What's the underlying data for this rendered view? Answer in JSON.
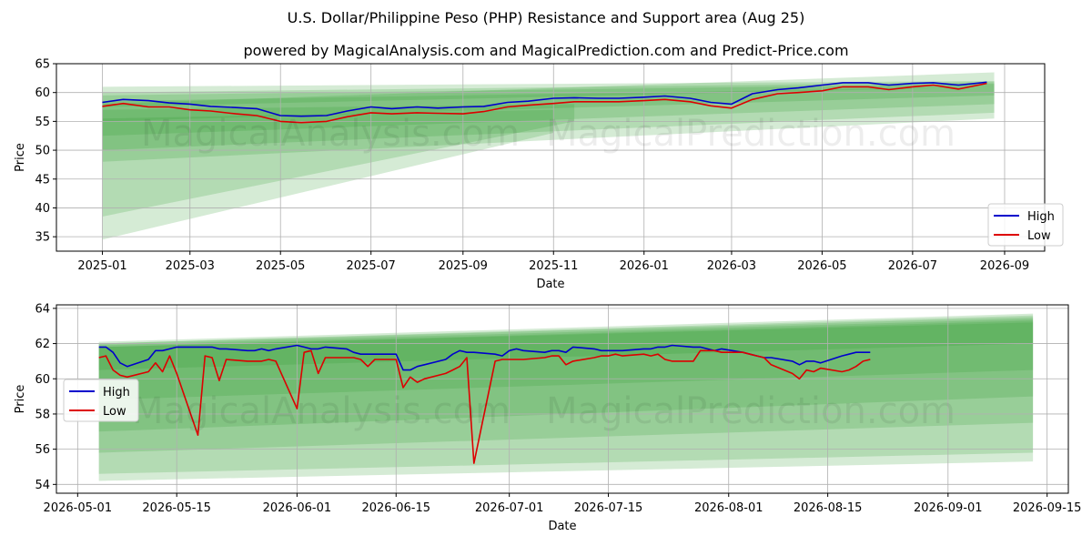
{
  "page": {
    "title": "U.S. Dollar/Philippine Peso (PHP) Resistance and Support area (Aug 25)",
    "subtitle": "powered by MagicalAnalysis.com and MagicalPrediction.com and Predict-Price.com",
    "watermark": "MagicalAnalysis.com    MagicalPrediction.com"
  },
  "colors": {
    "high": "#0000cc",
    "low": "#dd0000",
    "band": "#2e9a2e"
  },
  "chart_data": [
    {
      "type": "line",
      "xlabel": "Date",
      "ylabel": "Price",
      "ylim": [
        32.5,
        65
      ],
      "yticks": [
        35,
        40,
        45,
        50,
        55,
        60,
        65
      ],
      "xticks": [
        "2025-01",
        "2025-03",
        "2025-05",
        "2025-07",
        "2025-09",
        "2025-11",
        "2026-01",
        "2026-03",
        "2026-05",
        "2026-07",
        "2026-09"
      ],
      "legend": "lower-right",
      "grid": true,
      "x": [
        "2025-01-01",
        "2025-01-15",
        "2025-02-01",
        "2025-02-15",
        "2025-03-01",
        "2025-03-15",
        "2025-04-01",
        "2025-04-15",
        "2025-05-01",
        "2025-05-15",
        "2025-06-01",
        "2025-06-15",
        "2025-07-01",
        "2025-07-15",
        "2025-08-01",
        "2025-08-15",
        "2025-09-01",
        "2025-09-15",
        "2025-10-01",
        "2025-10-15",
        "2025-11-01",
        "2025-11-15",
        "2025-12-01",
        "2025-12-15",
        "2026-01-01",
        "2026-01-15",
        "2026-02-01",
        "2026-02-15",
        "2026-03-01",
        "2026-03-15",
        "2026-04-01",
        "2026-04-15",
        "2026-05-01",
        "2026-05-15",
        "2026-06-01",
        "2026-06-15",
        "2026-07-01",
        "2026-07-15",
        "2026-08-01",
        "2026-08-20"
      ],
      "series": [
        {
          "name": "High",
          "values": [
            58.3,
            58.8,
            58.6,
            58.2,
            58.0,
            57.6,
            57.4,
            57.2,
            56.0,
            55.9,
            56.0,
            56.8,
            57.5,
            57.2,
            57.5,
            57.3,
            57.5,
            57.6,
            58.3,
            58.5,
            59.0,
            59.1,
            59.0,
            59.0,
            59.2,
            59.4,
            59.0,
            58.3,
            58.0,
            59.8,
            60.5,
            60.8,
            61.3,
            61.7,
            61.7,
            61.3,
            61.6,
            61.7,
            61.3,
            61.8
          ]
        },
        {
          "name": "Low",
          "values": [
            57.6,
            58.1,
            57.5,
            57.5,
            57.0,
            56.8,
            56.3,
            56.0,
            55.0,
            54.8,
            55.0,
            55.8,
            56.5,
            56.3,
            56.5,
            56.4,
            56.3,
            56.7,
            57.5,
            57.8,
            58.1,
            58.4,
            58.4,
            58.4,
            58.6,
            58.8,
            58.4,
            57.7,
            57.3,
            58.8,
            59.8,
            60.0,
            60.3,
            61.0,
            61.0,
            60.5,
            61.0,
            61.3,
            60.6,
            61.6
          ]
        }
      ],
      "bands": [
        {
          "start_date": "2025-01-01",
          "end_date": "2026-08-25",
          "start": [
            57.5,
            61.0
          ],
          "end": [
            61.0,
            62.0
          ]
        },
        {
          "start_date": "2025-01-01",
          "end_date": "2026-08-25",
          "start": [
            55.0,
            60.0
          ],
          "end": [
            59.5,
            61.8
          ]
        },
        {
          "start_date": "2025-01-01",
          "end_date": "2026-08-25",
          "start": [
            52.5,
            59.5
          ],
          "end": [
            58.0,
            61.5
          ]
        },
        {
          "start_date": "2025-01-01",
          "end_date": "2026-08-25",
          "start": [
            50.0,
            58.5
          ],
          "end": [
            56.5,
            61.0
          ]
        },
        {
          "start_date": "2025-01-01",
          "end_date": "2026-08-25",
          "start": [
            48.0,
            58.0
          ],
          "end": [
            55.5,
            63.5
          ]
        },
        {
          "start_date": "2025-01-01",
          "end_date": "2025-11-15",
          "start": [
            38.5,
            57.0
          ],
          "end": [
            55.0,
            58.0
          ]
        },
        {
          "start_date": "2025-01-01",
          "end_date": "2025-11-01",
          "start": [
            34.5,
            55.5
          ],
          "end": [
            53.0,
            57.0
          ]
        }
      ]
    },
    {
      "type": "line",
      "xlabel": "Date",
      "ylabel": "Price",
      "ylim": [
        53.5,
        64.2
      ],
      "yticks": [
        54,
        56,
        58,
        60,
        62,
        64
      ],
      "xticks": [
        "2026-05-01",
        "2026-05-15",
        "2026-06-01",
        "2026-06-15",
        "2026-07-01",
        "2026-07-15",
        "2026-08-01",
        "2026-08-15",
        "2026-09-01",
        "2026-09-15"
      ],
      "legend": "center-left",
      "grid": true,
      "x": [
        "2026-05-04",
        "2026-05-05",
        "2026-05-06",
        "2026-05-07",
        "2026-05-08",
        "2026-05-11",
        "2026-05-12",
        "2026-05-13",
        "2026-05-14",
        "2026-05-15",
        "2026-05-18",
        "2026-05-19",
        "2026-05-20",
        "2026-05-21",
        "2026-05-22",
        "2026-05-25",
        "2026-05-26",
        "2026-05-27",
        "2026-05-28",
        "2026-05-29",
        "2026-06-01",
        "2026-06-02",
        "2026-06-03",
        "2026-06-04",
        "2026-06-05",
        "2026-06-08",
        "2026-06-09",
        "2026-06-10",
        "2026-06-11",
        "2026-06-12",
        "2026-06-15",
        "2026-06-16",
        "2026-06-17",
        "2026-06-18",
        "2026-06-19",
        "2026-06-22",
        "2026-06-23",
        "2026-06-24",
        "2026-06-25",
        "2026-06-26",
        "2026-06-29",
        "2026-06-30",
        "2026-07-01",
        "2026-07-02",
        "2026-07-03",
        "2026-07-06",
        "2026-07-07",
        "2026-07-08",
        "2026-07-09",
        "2026-07-10",
        "2026-07-13",
        "2026-07-14",
        "2026-07-15",
        "2026-07-16",
        "2026-07-17",
        "2026-07-20",
        "2026-07-21",
        "2026-07-22",
        "2026-07-23",
        "2026-07-24",
        "2026-07-27",
        "2026-07-28",
        "2026-07-29",
        "2026-07-30",
        "2026-07-31",
        "2026-08-03",
        "2026-08-04",
        "2026-08-05",
        "2026-08-06",
        "2026-08-07",
        "2026-08-10",
        "2026-08-11",
        "2026-08-12",
        "2026-08-13",
        "2026-08-14",
        "2026-08-17",
        "2026-08-18",
        "2026-08-19",
        "2026-08-20",
        "2026-08-21"
      ],
      "series": [
        {
          "name": "High",
          "values": [
            61.8,
            61.8,
            61.5,
            60.9,
            60.7,
            61.1,
            61.6,
            61.6,
            61.7,
            61.8,
            61.8,
            61.8,
            61.8,
            61.7,
            61.7,
            61.6,
            61.6,
            61.7,
            61.6,
            61.7,
            61.9,
            61.8,
            61.7,
            61.7,
            61.8,
            61.7,
            61.5,
            61.4,
            61.4,
            61.4,
            61.4,
            60.5,
            60.5,
            60.7,
            60.8,
            61.1,
            61.4,
            61.6,
            61.5,
            61.5,
            61.4,
            61.3,
            61.6,
            61.7,
            61.6,
            61.5,
            61.6,
            61.6,
            61.5,
            61.8,
            61.7,
            61.6,
            61.6,
            61.6,
            61.6,
            61.7,
            61.7,
            61.8,
            61.8,
            61.9,
            61.8,
            61.8,
            61.7,
            61.6,
            61.7,
            61.5,
            61.4,
            61.3,
            61.2,
            61.2,
            61.0,
            60.8,
            61.0,
            61.0,
            60.9,
            61.3,
            61.4,
            61.5,
            61.5,
            61.5,
            61.6,
            61.7,
            61.9,
            62.0,
            61.9,
            61.8,
            61.8
          ]
        },
        {
          "name": "Low",
          "values": [
            61.2,
            61.3,
            60.5,
            60.2,
            60.1,
            60.4,
            60.9,
            60.4,
            61.3,
            60.3,
            56.8,
            61.3,
            61.2,
            59.9,
            61.1,
            61.0,
            61.0,
            61.0,
            61.1,
            61.0,
            58.3,
            61.5,
            61.6,
            60.3,
            61.2,
            61.2,
            61.2,
            61.1,
            60.7,
            61.1,
            61.1,
            59.5,
            60.1,
            59.8,
            60.0,
            60.3,
            60.5,
            60.7,
            61.2,
            55.2,
            61.0,
            61.1,
            61.1,
            61.1,
            61.1,
            61.2,
            61.3,
            61.3,
            60.8,
            61.0,
            61.2,
            61.3,
            61.3,
            61.4,
            61.3,
            61.4,
            61.3,
            61.4,
            61.1,
            61.0,
            61.0,
            61.6,
            61.6,
            61.6,
            61.5,
            61.5,
            61.4,
            61.3,
            61.2,
            60.8,
            60.3,
            60.0,
            60.5,
            60.4,
            60.6,
            60.4,
            60.5,
            60.7,
            61.0,
            61.1,
            61.3,
            61.3,
            61.4,
            61.0,
            61.6,
            61.5,
            61.6
          ]
        }
      ],
      "bands": [
        {
          "start_date": "2026-05-04",
          "end_date": "2026-09-13",
          "start": [
            60.5,
            61.8
          ],
          "end": [
            62.0,
            63.2
          ]
        },
        {
          "start_date": "2026-05-04",
          "end_date": "2026-09-13",
          "start": [
            58.8,
            61.8
          ],
          "end": [
            60.5,
            63.3
          ]
        },
        {
          "start_date": "2026-05-04",
          "end_date": "2026-09-13",
          "start": [
            57.0,
            61.9
          ],
          "end": [
            59.0,
            63.4
          ]
        },
        {
          "start_date": "2026-05-04",
          "end_date": "2026-09-13",
          "start": [
            55.8,
            62.0
          ],
          "end": [
            57.5,
            63.5
          ]
        },
        {
          "start_date": "2026-05-04",
          "end_date": "2026-09-13",
          "start": [
            54.6,
            62.0
          ],
          "end": [
            55.8,
            63.6
          ]
        },
        {
          "start_date": "2026-05-04",
          "end_date": "2026-09-13",
          "start": [
            54.2,
            62.1
          ],
          "end": [
            55.3,
            63.7
          ]
        }
      ]
    }
  ]
}
